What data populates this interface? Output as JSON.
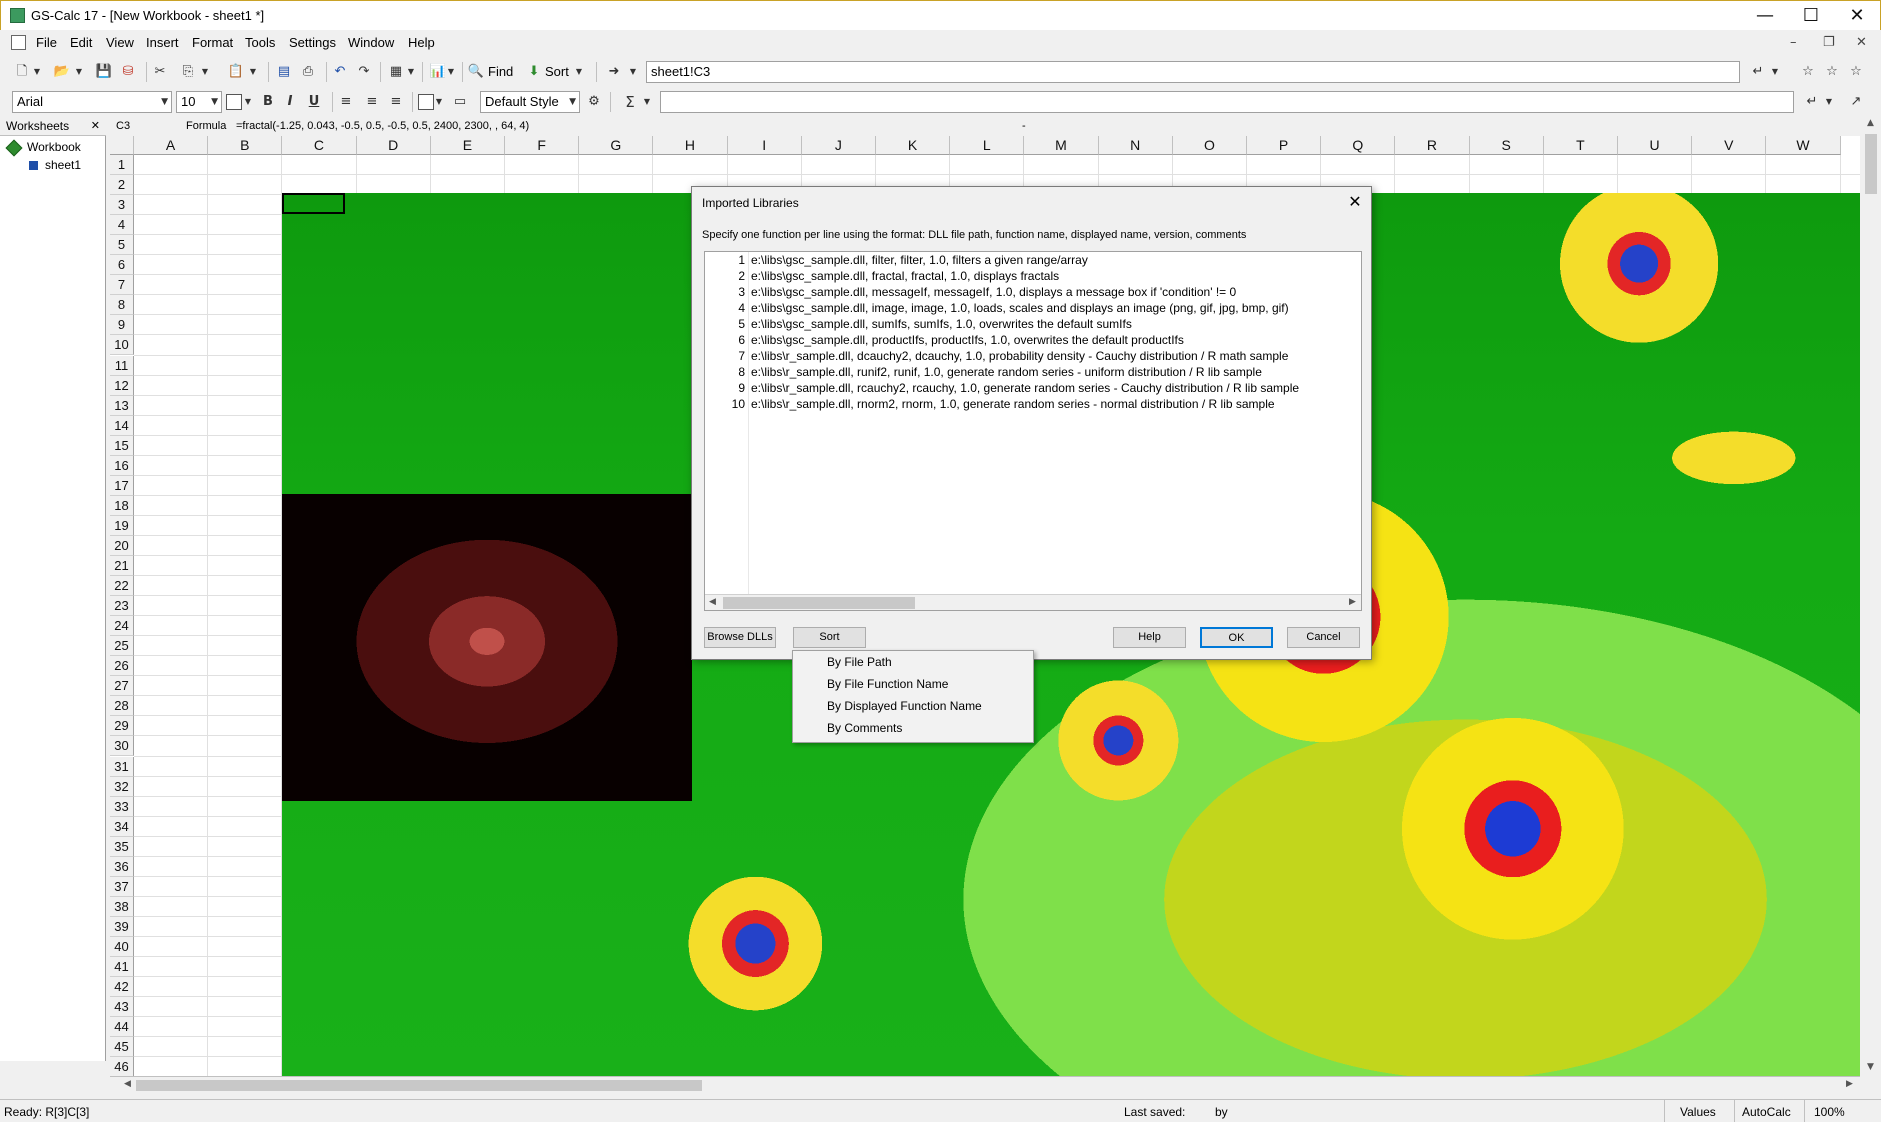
{
  "window": {
    "title": "GS-Calc 17 - [New Workbook - sheet1 *]",
    "min": "—",
    "max": "☐",
    "close": "✕"
  },
  "menu": {
    "items": [
      "File",
      "Edit",
      "View",
      "Insert",
      "Format",
      "Tools",
      "Settings",
      "Window",
      "Help"
    ]
  },
  "toolbar1": {
    "find_label": "Find",
    "sort_label": "Sort",
    "cell_ref": "sheet1!C3"
  },
  "toolbar2": {
    "font": "Arial",
    "size": "10",
    "style": "Default Style",
    "sigma": "Σ",
    "bold": "B",
    "italic": "I",
    "underline": "U"
  },
  "sidebar": {
    "header": "Worksheets",
    "close": "✕",
    "tree": [
      "Workbook",
      "sheet1"
    ]
  },
  "formulabar": {
    "cell": "C3",
    "label": "Formula",
    "formula": "=fractal(-1.25, 0.043, -0.5, 0.5, -0.5, 0.5, 2400, 2300, , 64, 4)",
    "dash": "-"
  },
  "columns": [
    "A",
    "B",
    "C",
    "D",
    "E",
    "F",
    "G",
    "H",
    "I",
    "J",
    "K",
    "L",
    "M",
    "N",
    "O",
    "P",
    "Q",
    "R",
    "S",
    "T",
    "U",
    "V",
    "W"
  ],
  "rows": [
    "1",
    "2",
    "3",
    "4",
    "5",
    "6",
    "7",
    "8",
    "9",
    "10",
    "11",
    "12",
    "13",
    "14",
    "15",
    "16",
    "17",
    "18",
    "19",
    "20",
    "21",
    "22",
    "23",
    "24",
    "25",
    "26",
    "27",
    "28",
    "29",
    "30",
    "31",
    "32",
    "33",
    "34",
    "35",
    "36",
    "37",
    "38",
    "39",
    "40",
    "41",
    "42",
    "43",
    "44",
    "45",
    "46"
  ],
  "dialog": {
    "title": "Imported Libraries",
    "close": "✕",
    "instructions": "Specify one function per line using the format:  DLL file path, function name, displayed name, version, comments",
    "lines": [
      {
        "n": "1",
        "text": "e:\\libs\\gsc_sample.dll, filter, filter, 1.0, filters a given range/array"
      },
      {
        "n": "2",
        "text": "e:\\libs\\gsc_sample.dll, fractal, fractal, 1.0, displays fractals"
      },
      {
        "n": "3",
        "text": "e:\\libs\\gsc_sample.dll, messageIf, messageIf, 1.0, displays a message box if 'condition' != 0"
      },
      {
        "n": "4",
        "text": "e:\\libs\\gsc_sample.dll, image, image, 1.0, loads, scales and displays an image (png, gif, jpg, bmp, gif)"
      },
      {
        "n": "5",
        "text": "e:\\libs\\gsc_sample.dll, sumIfs, sumIfs, 1.0, overwrites the default sumIfs"
      },
      {
        "n": "6",
        "text": "e:\\libs\\gsc_sample.dll, productIfs, productIfs, 1.0, overwrites the default productIfs"
      },
      {
        "n": "7",
        "text": "e:\\libs\\r_sample.dll, dcauchy2, dcauchy, 1.0, probability density - Cauchy distribution / R math sample"
      },
      {
        "n": "8",
        "text": "e:\\libs\\r_sample.dll, runif2, runif, 1.0, generate random series - uniform distribution / R lib sample"
      },
      {
        "n": "9",
        "text": "e:\\libs\\r_sample.dll, rcauchy2, rcauchy, 1.0, generate random series - Cauchy distribution / R lib sample"
      },
      {
        "n": "10",
        "text": "e:\\libs\\r_sample.dll, rnorm2, rnorm, 1.0, generate random series - normal distribution / R lib sample"
      }
    ],
    "browse": "Browse DLLs",
    "sort": "Sort",
    "help": "Help",
    "ok": "OK",
    "cancel": "Cancel"
  },
  "sort_menu": [
    "By File Path",
    "By File Function Name",
    "By Displayed Function Name",
    "By Comments"
  ],
  "status": {
    "ready": "Ready:  R[3]C[3]",
    "last_saved": "Last saved:",
    "by": "by",
    "values": "Values",
    "autocalc": "AutoCalc",
    "zoom": "100%"
  }
}
